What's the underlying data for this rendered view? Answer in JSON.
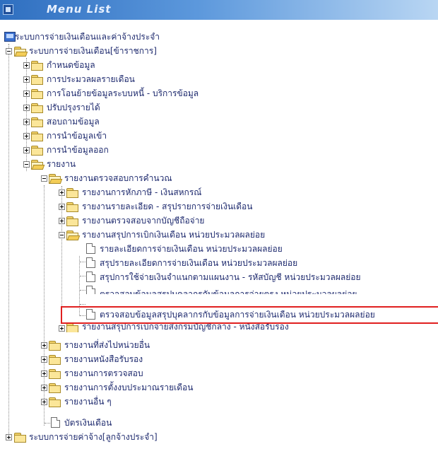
{
  "header": {
    "title": "Menu List"
  },
  "tree": {
    "root": "ระบบการจ่ายเงินเดือนและค่าจ้างประจำ",
    "n1": "ระบบการจ่ายเงินเดือน[ข้าราชการ]",
    "n1_items": [
      "กำหนดข้อมูล",
      "การประมวลผลรายเดือน",
      "การโอนย้ายข้อมูลระบบหนี้ - บริการข้อมูล",
      "ปรับปรุงรายได้",
      "สอบถามข้อมูล",
      "การนำข้อมูลเข้า",
      "การนำข้อมูลออก"
    ],
    "reports": "รายงาน",
    "check": "รายงานตรวจสอบการคำนวณ",
    "check_items": [
      "รายงานการหักภาษี - เงินสหกรณ์",
      "รายงานรายละเอียด - สรุปรายการจ่ายเงินเดือน",
      "รายงานตรวจสอบจากบัญชีถือจ่าย"
    ],
    "summary": "รายงานสรุปการเบิกเงินเดือน หน่วยประมวลผลย่อย",
    "summary_docs": [
      "รายละเอียดการจ่ายเงินเดือน หน่วยประมวลผลย่อย",
      "สรุปรายละเอียดการจ่ายเงินเดือน หน่วยประมวลผลย่อย",
      "สรุปการใช้จ่ายเงินจำแนกตามแผนงาน - รหัสบัญชี หน่วยประมวลผลย่อย",
      "ตรวจสอบข้อมูลสรุปบุคลากรกับข้อมูลการจ่ายตรง หน่วยประมวลผลย่อย",
      "ตรวจสอบข้อมูลสรุปบุคลากรกับข้อมูลการจ่ายเงินเดือน หน่วยประมวลผลย่อย"
    ],
    "central": "รายงานสรุปการเบิกจ่ายส่งกรมบัญชีกลาง - หนังสือรับรอง",
    "report_items": [
      "รายงานที่ส่งไปหน่วยอื่น",
      "รายงานหนังสือรับรอง",
      "รายงานการตรวจสอบ",
      "รายงานการตั้งงบประมาณรายเดือน",
      "รายงานอื่น ๆ"
    ],
    "card": "บัตรเงินเดือน",
    "n2": "ระบบการจ่ายค่าจ้าง[ลูกจ้างประจำ]"
  }
}
